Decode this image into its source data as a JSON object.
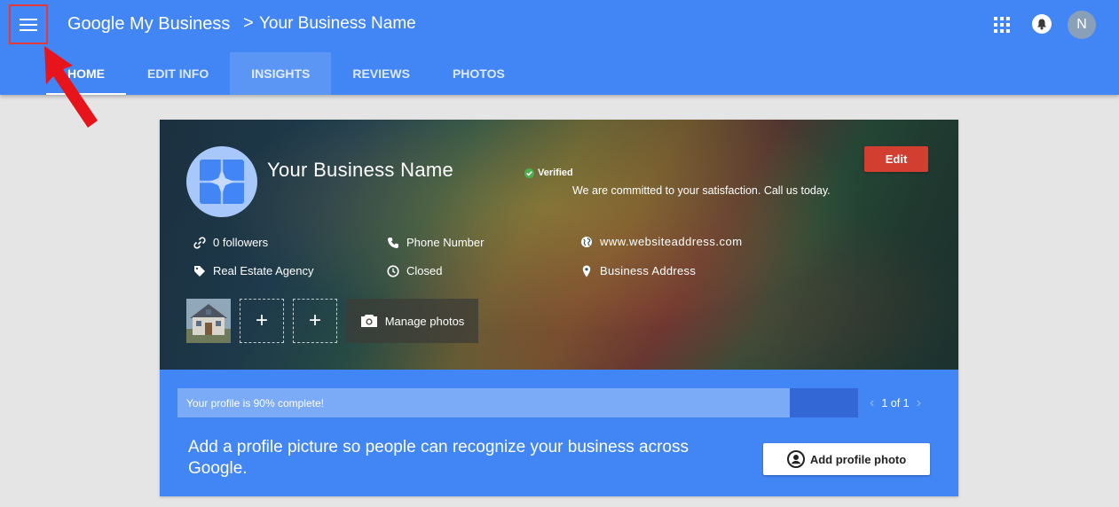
{
  "header": {
    "app_title": "Google My Business",
    "breadcrumb_separator": ">",
    "business_name": "Your Business Name",
    "avatar_initial": "N",
    "brand_color": "#4285f4"
  },
  "tabs": [
    {
      "label": "HOME",
      "state": "active"
    },
    {
      "label": "EDIT INFO",
      "state": "normal"
    },
    {
      "label": "INSIGHTS",
      "state": "hover"
    },
    {
      "label": "REVIEWS",
      "state": "normal"
    },
    {
      "label": "PHOTOS",
      "state": "normal"
    }
  ],
  "profile": {
    "name": "Your Business Name",
    "verified_label": "Verified",
    "tagline": "We are committed to your satisfaction. Call us today.",
    "edit_label": "Edit",
    "followers": "0 followers",
    "category": "Real Estate Agency",
    "phone": "Phone Number",
    "hours": "Closed",
    "website": "www.websiteaddress.com",
    "address": "Business Address",
    "add_photo_symbol": "+",
    "manage_photos_label": "Manage photos"
  },
  "completion": {
    "label": "Your profile is 90% complete!",
    "percent": 90,
    "pager": "1 of 1",
    "prompt": "Add a profile picture so people can recognize your business across Google.",
    "button_label": "Add profile photo"
  }
}
